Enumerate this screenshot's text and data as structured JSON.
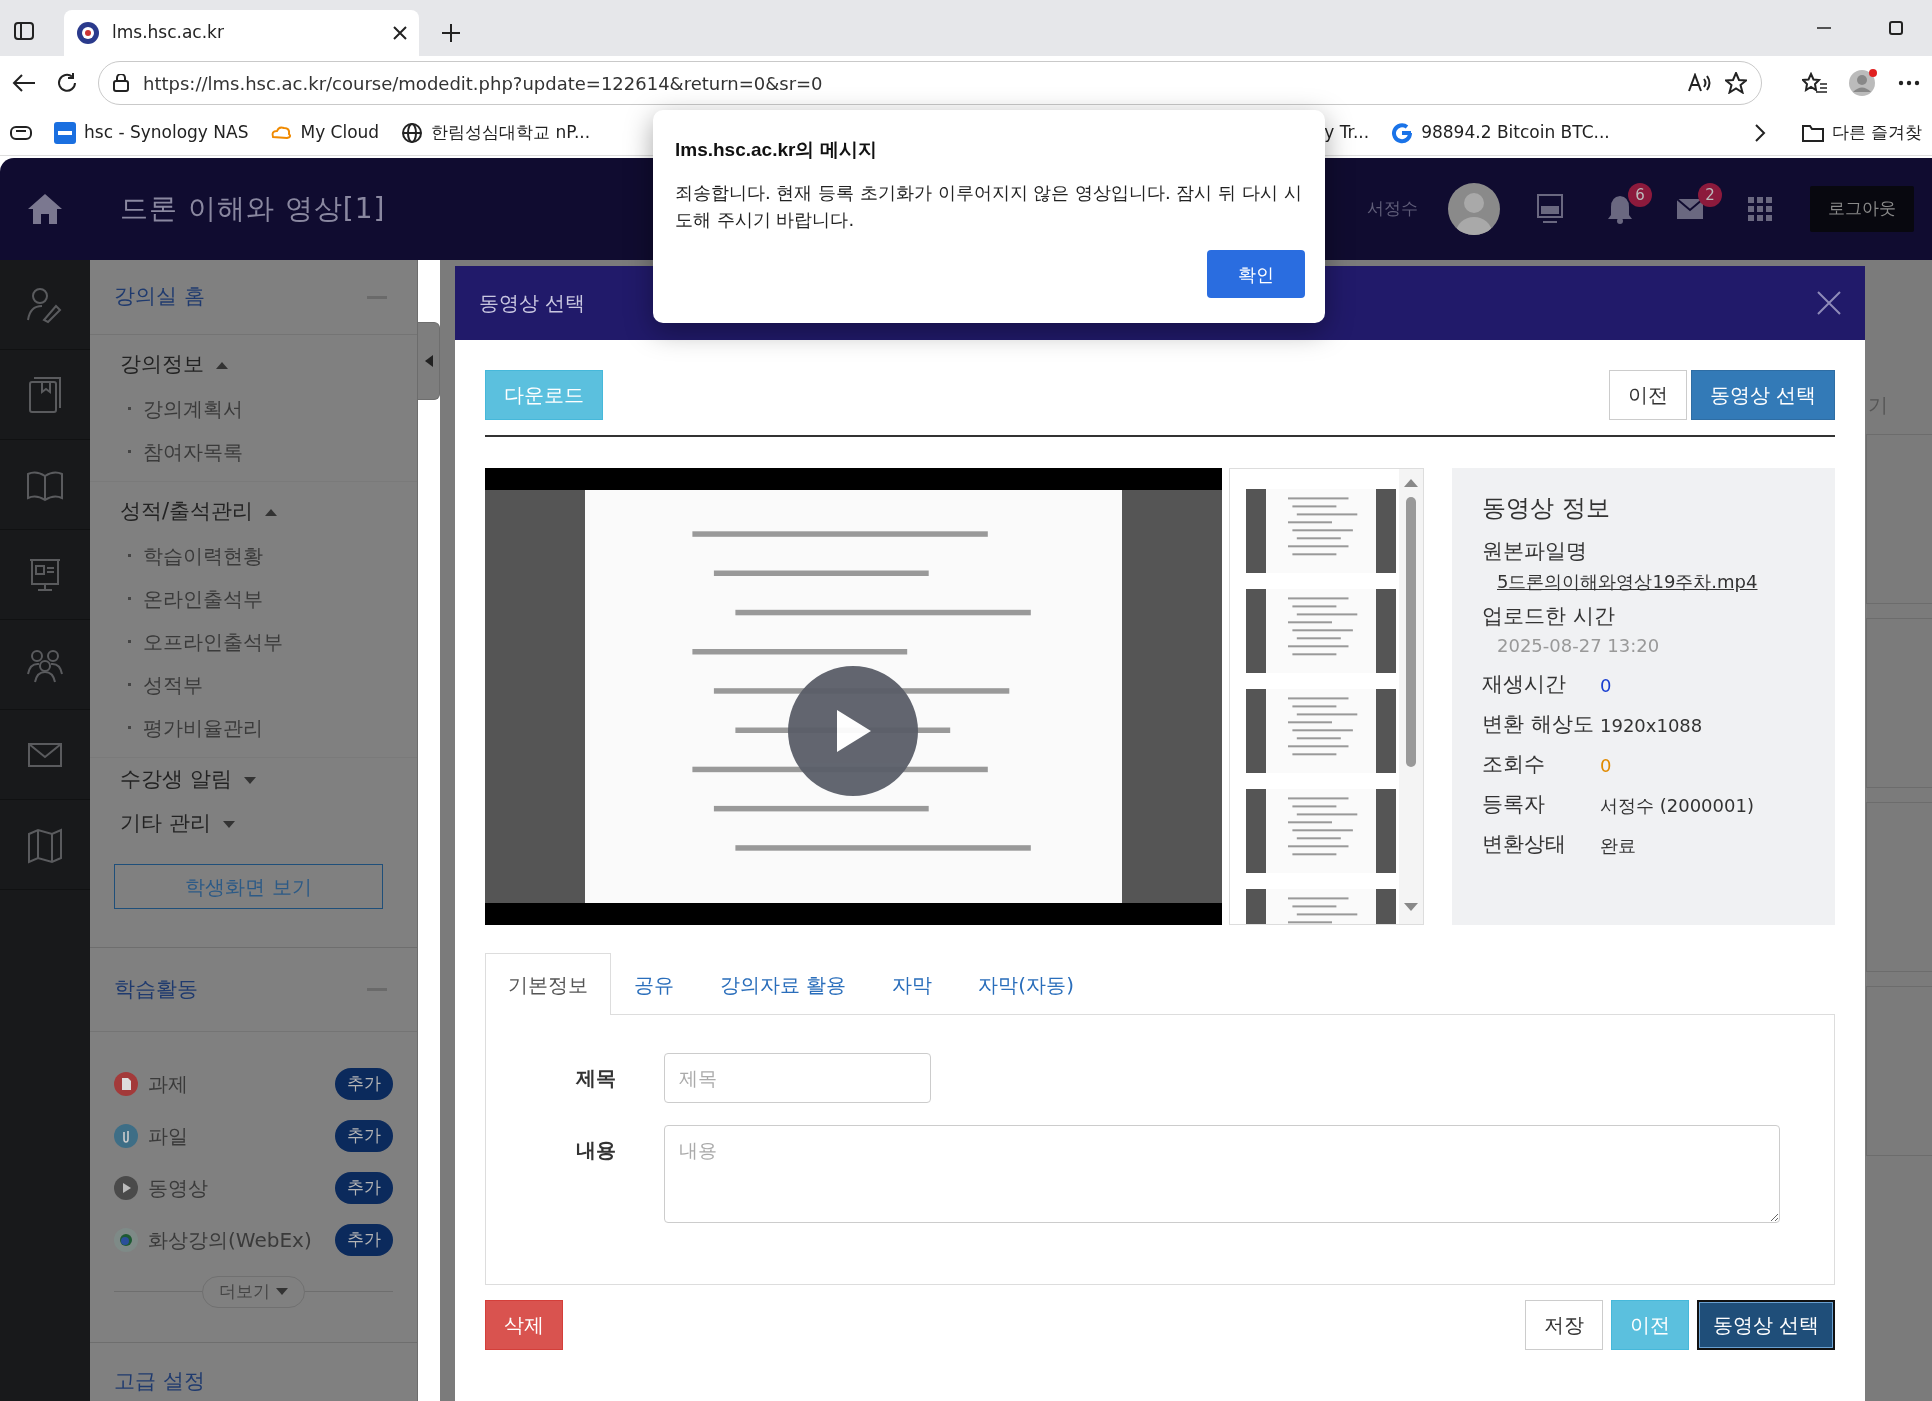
{
  "browser": {
    "tab_title": "lms.hsc.ac.kr",
    "url": "https://lms.hsc.ac.kr/course/modedit.php?update=122614&return=0&sr=0",
    "bookmarks": [
      {
        "kind": "synology",
        "label": "hsc - Synology NAS"
      },
      {
        "kind": "cloud",
        "label": "My Cloud"
      },
      {
        "kind": "globe",
        "label": "한림성심대학교 nP..."
      },
      {
        "kind": "plain",
        "label": "y Tr..."
      },
      {
        "kind": "google",
        "label": "98894.2 Bitcoin BTC..."
      }
    ],
    "folder": "다른 즐겨찾"
  },
  "header": {
    "course_title": "드론 이해와 영상[1]",
    "user_name": "서정수",
    "notifications": "6",
    "messages": "2",
    "logout": "로그아웃"
  },
  "sidebar": {
    "home_title": "강의실 홈",
    "sections": [
      {
        "label": "강의정보",
        "expanded": true,
        "children": [
          {
            "label": "강의계획서"
          },
          {
            "label": "참여자목록"
          }
        ]
      },
      {
        "label": "성적/출석관리",
        "expanded": true,
        "children": [
          {
            "label": "학습이력현황"
          },
          {
            "label": "온라인출석부"
          },
          {
            "label": "오프라인출석부"
          },
          {
            "label": "성적부"
          },
          {
            "label": "평가비율관리"
          }
        ]
      },
      {
        "label": "수강생 알림",
        "expanded": false
      },
      {
        "label": "기타 관리",
        "expanded": false
      }
    ],
    "student_view": "학생화면 보기",
    "activities_title": "학습활동",
    "activities": [
      {
        "kind": "assignment",
        "label": "과제",
        "add": "추가"
      },
      {
        "kind": "file",
        "label": "파일",
        "add": "추가"
      },
      {
        "kind": "video",
        "label": "동영상",
        "add": "추가"
      },
      {
        "kind": "webex",
        "label": "화상강의(WebEx)",
        "add": "추가"
      }
    ],
    "more": "더보기",
    "advanced_title": "고급 설정"
  },
  "background_text": "기",
  "modal": {
    "title": "동영상 선택",
    "download": "다운로드",
    "prev": "이전",
    "select": "동영상 선택",
    "info": {
      "heading": "동영상 정보",
      "fields": [
        {
          "kind": "link",
          "label": "원본파일명",
          "value": "5드론의이해와영상19주차.mp4"
        },
        {
          "kind": "stacked",
          "label": "업로드한 시간",
          "value": "2025-08-27 13:20"
        },
        {
          "kind": "inline",
          "label": "재생시간",
          "value": "0",
          "color": "#1a3fd0"
        },
        {
          "kind": "inline",
          "label": "변환 해상도",
          "value": "1920x1088"
        },
        {
          "kind": "inline",
          "label": "조회수",
          "value": "0",
          "color": "#e08a00"
        },
        {
          "kind": "inline",
          "label": "등록자",
          "value": "서정수 (2000001)"
        },
        {
          "kind": "inline",
          "label": "변환상태",
          "value": "완료"
        }
      ]
    },
    "tabs": [
      {
        "label": "기본정보",
        "selected": true
      },
      {
        "label": "공유",
        "selected": false
      },
      {
        "label": "강의자료 활용",
        "selected": false
      },
      {
        "label": "자막",
        "selected": false
      },
      {
        "label": "자막(자동)",
        "selected": false
      }
    ],
    "form": {
      "title_label": "제목",
      "title_placeholder": "제목",
      "content_label": "내용",
      "content_placeholder": "내용"
    },
    "footer": {
      "delete": "삭제",
      "save": "저장",
      "prev": "이전",
      "select": "동영상 선택"
    }
  },
  "alert": {
    "title": "lms.hsc.ac.kr의 메시지",
    "message": "죄송합니다. 현재 등록 초기화가 이루어지지 않은 영상입니다. 잠시 뒤 다시 시도해 주시기 바랍니다.",
    "ok": "확인"
  }
}
